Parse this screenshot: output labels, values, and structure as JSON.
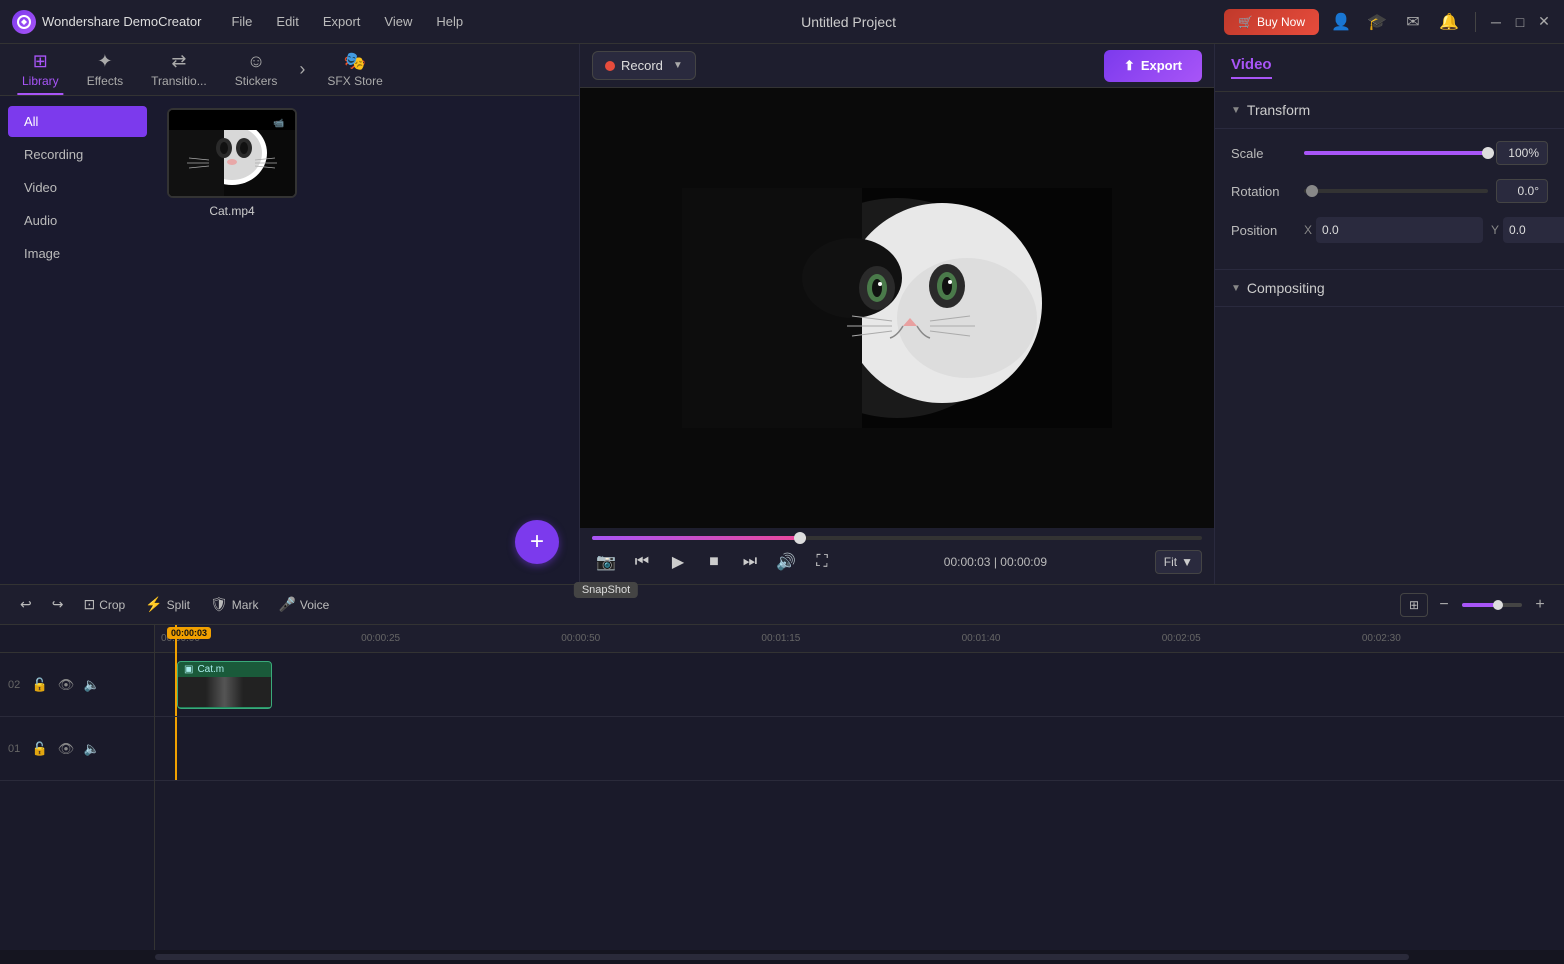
{
  "app": {
    "name": "Wondershare DemoCreator",
    "logo_symbol": "W",
    "title": "Untitled Project"
  },
  "menu": {
    "items": [
      "File",
      "Edit",
      "Export",
      "View",
      "Help"
    ]
  },
  "titlebar": {
    "buy_now": "Buy Now",
    "icons": [
      "user",
      "graduation",
      "mail",
      "bell"
    ]
  },
  "tabs": [
    {
      "id": "library",
      "label": "Library",
      "icon": "⊞",
      "active": true
    },
    {
      "id": "effects",
      "label": "Effects",
      "icon": "✦"
    },
    {
      "id": "transitions",
      "label": "Transitio...",
      "icon": "▶▶"
    },
    {
      "id": "stickers",
      "label": "Stickers",
      "icon": "☺"
    },
    {
      "id": "sfxstore",
      "label": "SFX Store",
      "icon": "🎭"
    }
  ],
  "library_nav": [
    {
      "id": "all",
      "label": "All",
      "active": true
    },
    {
      "id": "recording",
      "label": "Recording"
    },
    {
      "id": "video",
      "label": "Video"
    },
    {
      "id": "audio",
      "label": "Audio"
    },
    {
      "id": "image",
      "label": "Image"
    }
  ],
  "media": [
    {
      "name": "Cat.mp4",
      "type": "video"
    }
  ],
  "preview": {
    "record_label": "Record",
    "export_label": "Export",
    "time_current": "00:00:03",
    "time_total": "00:00:09",
    "fit_label": "Fit",
    "snapshot_tooltip": "SnapShot"
  },
  "video_properties": {
    "panel_title": "Video",
    "transform_label": "Transform",
    "compositing_label": "Compositing",
    "scale_label": "Scale",
    "scale_value": "100%",
    "scale_pct": 100,
    "rotation_label": "Rotation",
    "rotation_value": "0.0°",
    "rotation_pct": 2,
    "position_label": "Position",
    "position_x": "0.0",
    "position_y": "0.0",
    "x_label": "X",
    "y_label": "Y"
  },
  "timeline": {
    "undo_label": "Undo",
    "redo_label": "Redo",
    "crop_label": "Crop",
    "split_label": "Split",
    "mark_label": "Mark",
    "voice_label": "Voice",
    "ruler_marks": [
      "00:00:00",
      "00:00:25",
      "00:00:50",
      "00:01:15",
      "00:01:40",
      "00:02:05",
      "00:02:30"
    ],
    "tracks": [
      {
        "num": "02",
        "clip": {
          "name": "Cat.m",
          "has_content": true
        }
      },
      {
        "num": "01",
        "has_content": false
      }
    ],
    "playhead_time": "00:00:03"
  }
}
